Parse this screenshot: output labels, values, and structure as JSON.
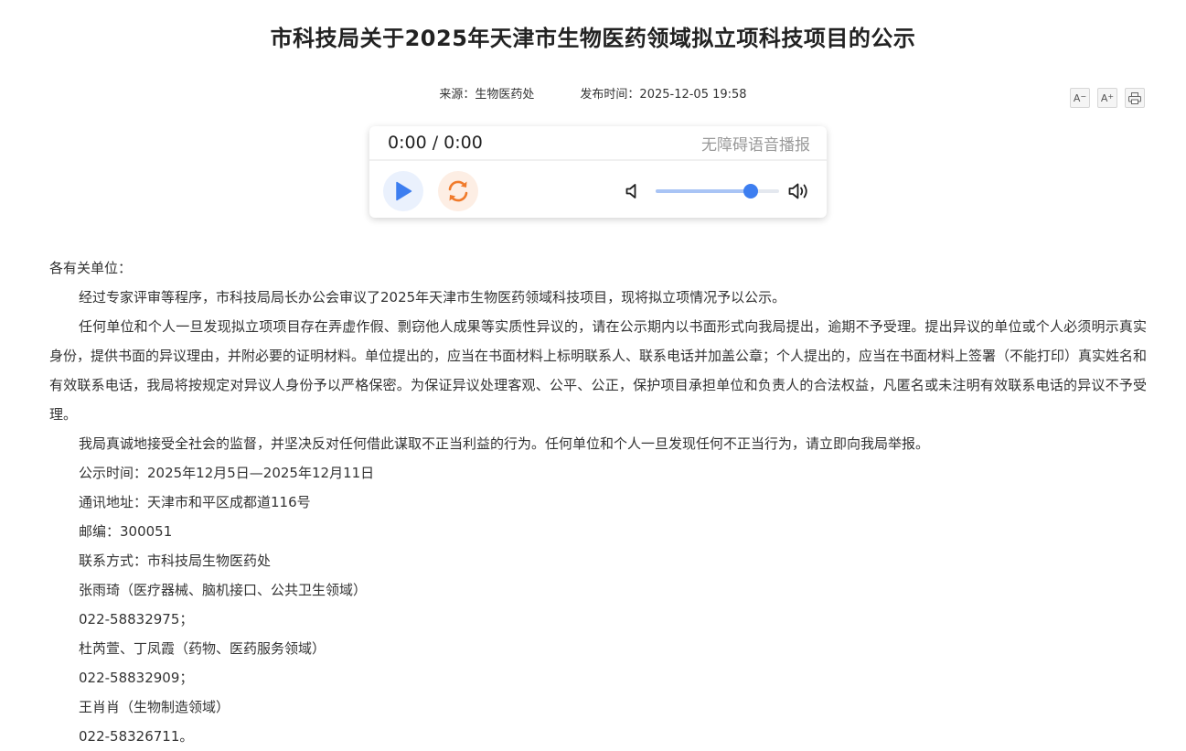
{
  "article": {
    "title": "市科技局关于2025年天津市生物医药领域拟立项科技项目的公示",
    "source": "来源：生物医药处",
    "publish_time": "发布时间：2025-12-05 19:58"
  },
  "tools": {
    "font_decrease": "A",
    "font_increase": "A",
    "font_decrease_sup": "−",
    "font_increase_sup": "+"
  },
  "player": {
    "time": "0:00 / 0:00",
    "label": "无障碍语音播报",
    "volume_level": 0.77,
    "accent_color": "#3d7ef0",
    "play_icon_color": "#3d7ef0",
    "loop_icon_color": "#f07a2a"
  },
  "body": {
    "salutation": "各有关单位：",
    "paragraphs": [
      "经过专家评审等程序，市科技局局长办公会审议了2025年天津市生物医药领域科技项目，现将拟立项情况予以公示。",
      "任何单位和个人一旦发现拟立项项目存在弄虚作假、剽窃他人成果等实质性异议的，请在公示期内以书面形式向我局提出，逾期不予受理。提出异议的单位或个人必须明示真实身份，提供书面的异议理由，并附必要的证明材料。单位提出的，应当在书面材料上标明联系人、联系电话并加盖公章；个人提出的，应当在书面材料上签署（不能打印）真实姓名和有效联系电话，我局将按规定对异议人身份予以严格保密。为保证异议处理客观、公平、公正，保护项目承担单位和负责人的合法权益，凡匿名或未注明有效联系电话的异议不予受理。",
      "我局真诚地接受全社会的监督，并坚决反对任何借此谋取不正当利益的行为。任何单位和个人一旦发现任何不正当行为，请立即向我局举报。",
      "公示时间：2025年12月5日—2025年12月11日",
      "通讯地址：天津市和平区成都道116号",
      "邮编：300051",
      "联系方式：市科技局生物医药处",
      "张雨琦（医疗器械、脑机接口、公共卫生领域）",
      "022-58832975；",
      "杜芮萱、丁凤霞（药物、医药服务领域）",
      "022-58832909；",
      "王肖肖（生物制造领域）",
      "022-58326711。"
    ]
  }
}
